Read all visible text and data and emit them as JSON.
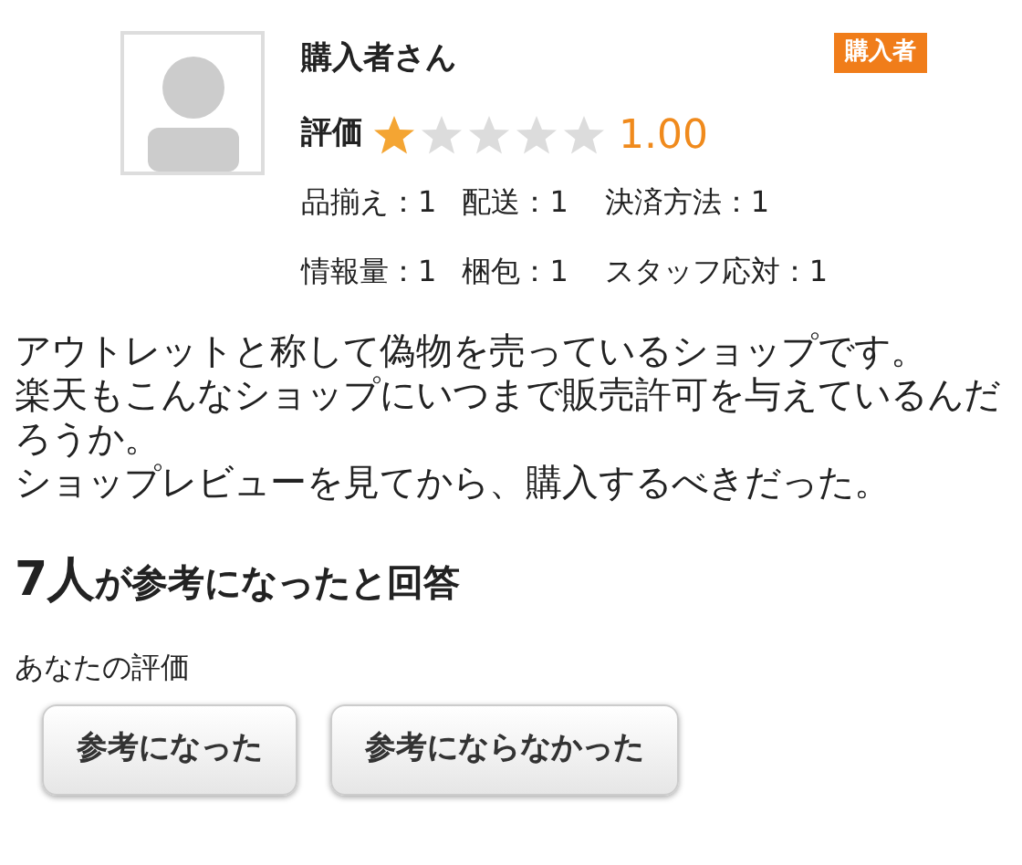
{
  "reviewer": {
    "name": "購入者さん",
    "badge": "購入者"
  },
  "rating": {
    "label": "評価",
    "stars": 1,
    "score": "1.00"
  },
  "sub_ratings": [
    [
      "品揃え：1",
      "配送：1",
      "決済方法：1"
    ],
    [
      "情報量：1",
      "梱包：1",
      "スタッフ応対：1"
    ]
  ],
  "review_paragraphs": [
    "アウトレットと称して偽物を売っているショップです。",
    "楽天もこんなショップにいつまで販売許可を与えているんだろうか。",
    "ショップレビューを見てから、購入するべきだった。"
  ],
  "helpful": {
    "count": "7人",
    "text": "が参考になったと回答"
  },
  "your_rating": {
    "label": "あなたの評価",
    "buttons": [
      "参考になった",
      "参考にならなかった"
    ]
  }
}
